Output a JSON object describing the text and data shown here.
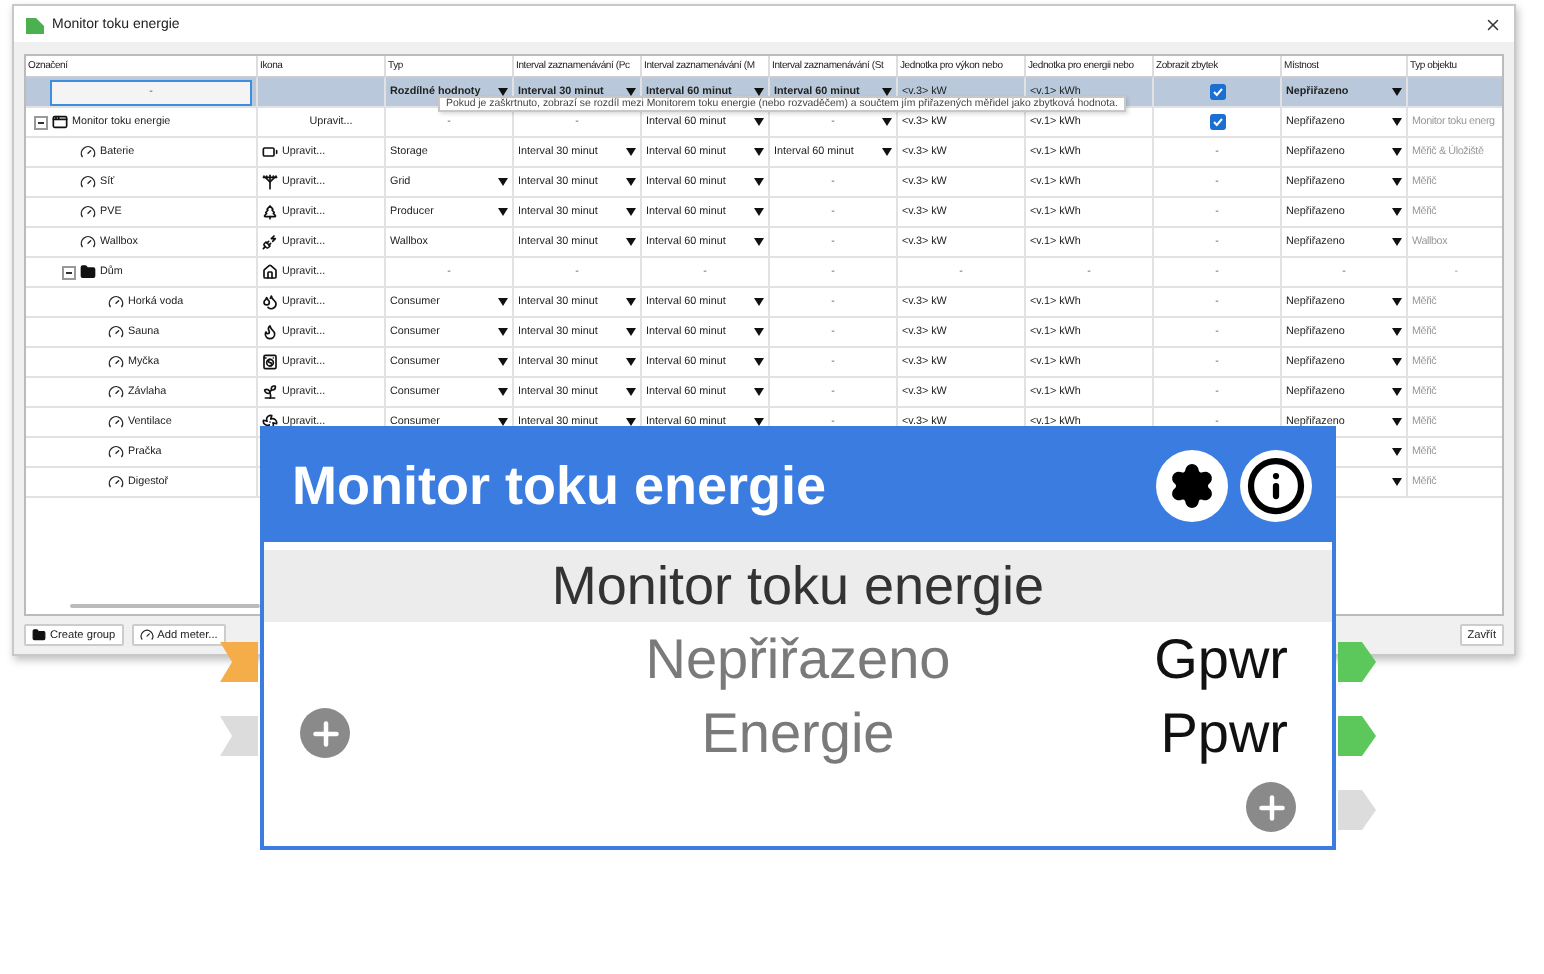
{
  "window": {
    "title": "Monitor toku energie"
  },
  "table": {
    "columns": [
      "Označení",
      "Ikona",
      "Typ",
      "Interval zaznamenávání (Pc",
      "Interval zaznamenávání (M",
      "Interval zaznamenávání (St",
      "Jednotka pro výkon nebo",
      "Jednotka pro energii nebo",
      "Zobrazit zbytek",
      "Místnost",
      "Typ objektu"
    ],
    "rows": [
      {
        "kind": "new",
        "selected": true,
        "cells": [
          "-",
          null,
          {
            "text": "Rozdílné hodnoty",
            "dropdown": true
          },
          {
            "text": "Interval 30 minut",
            "dropdown": true
          },
          {
            "text": "Interval 60 minut",
            "dropdown": true
          },
          {
            "text": "Interval 60 minut",
            "dropdown": true
          },
          "<v.3> kW",
          "<v.1> kWh",
          {
            "checked": true
          },
          {
            "text": "Nepřiřazeno",
            "dropdown": true
          },
          null
        ]
      },
      {
        "kind": "monitor",
        "selected": false,
        "expanded": true,
        "cells": [
          "Monitor toku energie",
          "Upravit...",
          "-",
          "-",
          {
            "text": "Interval 60 minut",
            "dropdown": true
          },
          {
            "text": "-",
            "dropdown": true
          },
          "<v.3> kW",
          "<v.1> kWh",
          {
            "checked": true
          },
          {
            "text": "Nepřiřazeno",
            "dropdown": true
          },
          "Monitor toku energ"
        ],
        "children": [
          {
            "kind": "meter",
            "selected": false,
            "cells": [
              "Baterie",
              "Upravit...",
              "Storage",
              {
                "text": "Interval 30 minut",
                "dropdown": true
              },
              {
                "text": "Interval 60 minut",
                "dropdown": true
              },
              {
                "text": "Interval 60 minut",
                "dropdown": true
              },
              "<v.3> kW",
              "<v.1> kWh",
              "-",
              {
                "text": "Nepřiřazeno",
                "dropdown": true
              },
              "Měřič & Úložiště"
            ]
          },
          {
            "kind": "meter",
            "selected": false,
            "cells": [
              "Síť",
              "Upravit...",
              {
                "text": "Grid",
                "dropdown": true
              },
              {
                "text": "Interval 30 minut",
                "dropdown": true
              },
              {
                "text": "Interval 60 minut",
                "dropdown": true
              },
              "-",
              "<v.3> kW",
              "<v.1> kWh",
              "-",
              {
                "text": "Nepřiřazeno",
                "dropdown": true
              },
              "Měřič"
            ]
          },
          {
            "kind": "meter",
            "selected": false,
            "cells": [
              "PVE",
              "Upravit...",
              {
                "text": "Producer",
                "dropdown": true
              },
              {
                "text": "Interval 30 minut",
                "dropdown": true
              },
              {
                "text": "Interval 60 minut",
                "dropdown": true
              },
              "-",
              "<v.3> kW",
              "<v.1> kWh",
              "-",
              {
                "text": "Nepřiřazeno",
                "dropdown": true
              },
              "Měřič"
            ]
          },
          {
            "kind": "meter",
            "selected": false,
            "cells": [
              "Wallbox",
              "Upravit...",
              "Wallbox",
              {
                "text": "Interval 30 minut",
                "dropdown": true
              },
              {
                "text": "Interval 60 minut",
                "dropdown": true
              },
              "-",
              "<v.3> kW",
              "<v.1> kWh",
              "-",
              {
                "text": "Nepřiřazeno",
                "dropdown": true
              },
              "Wallbox"
            ]
          },
          {
            "kind": "group",
            "selected": false,
            "expanded": true,
            "cells": [
              "Dům",
              "Upravit...",
              "-",
              "-",
              "-",
              "-",
              "-",
              "-",
              "-",
              "-",
              "-"
            ],
            "children": [
              {
                "kind": "meter",
                "selected": false,
                "cells": [
                  "Horká voda",
                  "Upravit...",
                  {
                    "text": "Consumer",
                    "dropdown": true
                  },
                  {
                    "text": "Interval 30 minut",
                    "dropdown": true
                  },
                  {
                    "text": "Interval 60 minut",
                    "dropdown": true
                  },
                  "-",
                  "<v.3> kW",
                  "<v.1> kWh",
                  "-",
                  {
                    "text": "Nepřiřazeno",
                    "dropdown": true
                  },
                  "Měřič"
                ]
              },
              {
                "kind": "meter",
                "selected": false,
                "cells": [
                  "Sauna",
                  "Upravit...",
                  {
                    "text": "Consumer",
                    "dropdown": true
                  },
                  {
                    "text": "Interval 30 minut",
                    "dropdown": true
                  },
                  {
                    "text": "Interval 60 minut",
                    "dropdown": true
                  },
                  "-",
                  "<v.3> kW",
                  "<v.1> kWh",
                  "-",
                  {
                    "text": "Nepřiřazeno",
                    "dropdown": true
                  },
                  "Měřič"
                ]
              },
              {
                "kind": "meter",
                "selected": false,
                "cells": [
                  "Myčka",
                  "Upravit...",
                  {
                    "text": "Consumer",
                    "dropdown": true
                  },
                  {
                    "text": "Interval 30 minut",
                    "dropdown": true
                  },
                  {
                    "text": "Interval 60 minut",
                    "dropdown": true
                  },
                  "-",
                  "<v.3> kW",
                  "<v.1> kWh",
                  "-",
                  {
                    "text": "Nepřiřazeno",
                    "dropdown": true
                  },
                  "Měřič"
                ]
              },
              {
                "kind": "meter",
                "selected": false,
                "cells": [
                  "Závlaha",
                  "Upravit...",
                  {
                    "text": "Consumer",
                    "dropdown": true
                  },
                  {
                    "text": "Interval 30 minut",
                    "dropdown": true
                  },
                  {
                    "text": "Interval 60 minut",
                    "dropdown": true
                  },
                  "-",
                  "<v.3> kW",
                  "<v.1> kWh",
                  "-",
                  {
                    "text": "Nepřiřazeno",
                    "dropdown": true
                  },
                  "Měřič"
                ]
              },
              {
                "kind": "meter",
                "selected": false,
                "cells": [
                  "Ventilace",
                  "Upravit...",
                  {
                    "text": "Consumer",
                    "dropdown": true
                  },
                  {
                    "text": "Interval 30 minut",
                    "dropdown": true
                  },
                  {
                    "text": "Interval 60 minut",
                    "dropdown": true
                  },
                  "-",
                  "<v.3> kW",
                  "<v.1> kWh",
                  "-",
                  {
                    "text": "Nepřiřazeno",
                    "dropdown": true
                  },
                  "Měřič"
                ]
              },
              {
                "kind": "meter",
                "selected": false,
                "cells": [
                  "Pračka",
                  null,
                  null,
                  null,
                  null,
                  null,
                  null,
                  null,
                  null,
                  {
                    "dropdown": true
                  },
                  "Měřič"
                ]
              },
              {
                "kind": "meter",
                "selected": false,
                "cells": [
                  "Digestoř",
                  null,
                  null,
                  null,
                  null,
                  null,
                  null,
                  null,
                  null,
                  {
                    "dropdown": true
                  },
                  "Měřič"
                ]
              }
            ]
          }
        ]
      }
    ]
  },
  "tooltip": "Pokud je zaškrtnuto, zobrazí se rozdíl mezi Monitorem toku energie (nebo rozvaděčem) a součtem jím přiřazených měřidel jako zbytková hodnota.",
  "buttons": [
    {
      "label": "Create group",
      "kind": "group"
    },
    {
      "label": "Add meter...",
      "kind": "meter"
    }
  ],
  "close_button": "Zavřít",
  "node": {
    "title": "Monitor toku energie",
    "subtitle": "Monitor toku energie",
    "inputs": [
      {
        "kind": "port",
        "label": "Nepřiřazeno",
        "color": "#f5ad4a"
      },
      {
        "kind": "add",
        "label": "Energie",
        "color": "#dcdcdc"
      }
    ],
    "outputs": [
      {
        "kind": "port",
        "label": "Gpwr",
        "color": "#5cc85c"
      },
      {
        "kind": "port",
        "label": "Ppwr",
        "color": "#5cc85c"
      },
      {
        "kind": "add",
        "color": "#dcdcdc"
      }
    ]
  }
}
